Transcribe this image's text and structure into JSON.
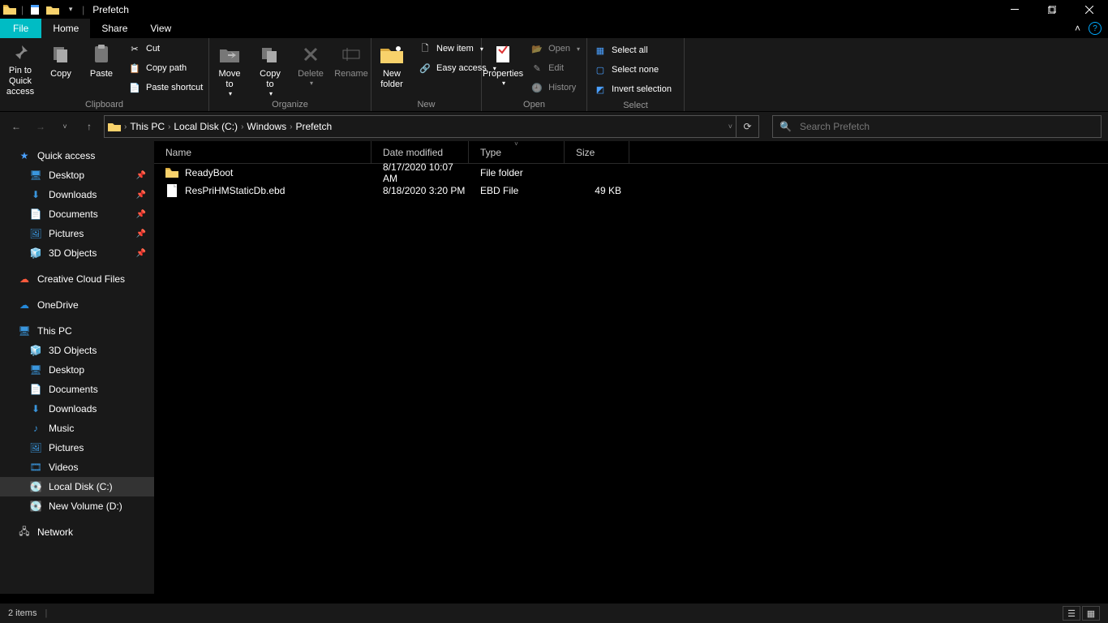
{
  "title": "Prefetch",
  "tabs": {
    "file": "File",
    "home": "Home",
    "share": "Share",
    "view": "View"
  },
  "ribbon": {
    "clipboard": {
      "pin": "Pin to Quick\naccess",
      "copy": "Copy",
      "paste": "Paste",
      "cut": "Cut",
      "copypath": "Copy path",
      "pasteshortcut": "Paste shortcut",
      "label": "Clipboard"
    },
    "organize": {
      "moveto": "Move\nto",
      "copyto": "Copy\nto",
      "delete": "Delete",
      "rename": "Rename",
      "label": "Organize"
    },
    "new": {
      "newfolder": "New\nfolder",
      "newitem": "New item",
      "easyaccess": "Easy access",
      "label": "New"
    },
    "open": {
      "properties": "Properties",
      "open": "Open",
      "edit": "Edit",
      "history": "History",
      "label": "Open"
    },
    "select": {
      "selectall": "Select all",
      "selectnone": "Select none",
      "invert": "Invert selection",
      "label": "Select"
    }
  },
  "breadcrumb": [
    "This PC",
    "Local Disk (C:)",
    "Windows",
    "Prefetch"
  ],
  "search_placeholder": "Search Prefetch",
  "nav": {
    "quick": "Quick access",
    "quick_items": [
      "Desktop",
      "Downloads",
      "Documents",
      "Pictures",
      "3D Objects"
    ],
    "ccf": "Creative Cloud Files",
    "onedrive": "OneDrive",
    "thispc": "This PC",
    "pc_items": [
      "3D Objects",
      "Desktop",
      "Documents",
      "Downloads",
      "Music",
      "Pictures",
      "Videos",
      "Local Disk (C:)",
      "New Volume (D:)"
    ],
    "network": "Network"
  },
  "columns": {
    "name": "Name",
    "date": "Date modified",
    "type": "Type",
    "size": "Size"
  },
  "files": [
    {
      "name": "ReadyBoot",
      "date": "8/17/2020 10:07 AM",
      "type": "File folder",
      "size": "",
      "kind": "folder"
    },
    {
      "name": "ResPriHMStaticDb.ebd",
      "date": "8/18/2020 3:20 PM",
      "type": "EBD File",
      "size": "49 KB",
      "kind": "file"
    }
  ],
  "status": "2 items"
}
